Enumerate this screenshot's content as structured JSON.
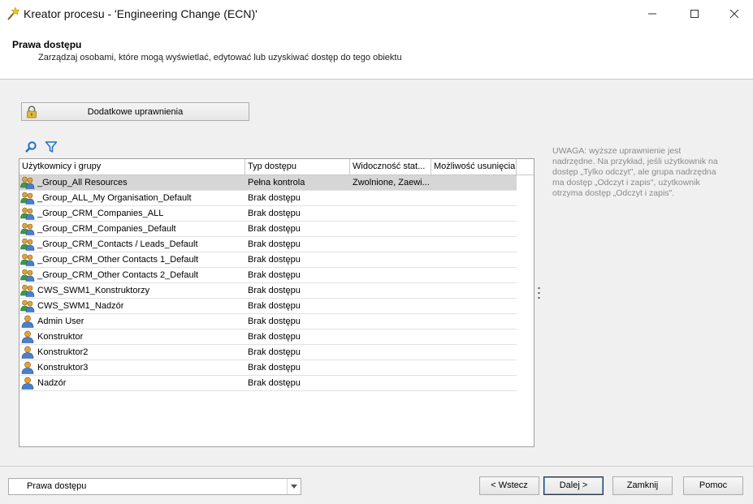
{
  "window": {
    "title": "Kreator procesu - 'Engineering Change (ECN)'"
  },
  "header": {
    "title": "Prawa dostępu",
    "subtitle": "Zarządzaj osobami, które mogą wyświetlać, edytować lub uzyskiwać dostęp do tego obiektu"
  },
  "toolbar": {
    "permissions_label": "Dodatkowe uprawnienia"
  },
  "grid": {
    "columns": [
      "Użytkownicy i grupy",
      "Typ dostępu",
      "Widoczność stat...",
      "Możliwość usunięcia"
    ],
    "rows": [
      {
        "name": "_Group_All Resources",
        "access": "Pełna kontrola",
        "visibility": "Zwolnione, Zaewi...",
        "deletion": "",
        "kind": "group"
      },
      {
        "name": "_Group_ALL_My Organisation_Default",
        "access": "Brak dostępu",
        "visibility": "",
        "deletion": "",
        "kind": "group"
      },
      {
        "name": "_Group_CRM_Companies_ALL",
        "access": "Brak dostępu",
        "visibility": "",
        "deletion": "",
        "kind": "group"
      },
      {
        "name": "_Group_CRM_Companies_Default",
        "access": "Brak dostępu",
        "visibility": "",
        "deletion": "",
        "kind": "group"
      },
      {
        "name": "_Group_CRM_Contacts / Leads_Default",
        "access": "Brak dostępu",
        "visibility": "",
        "deletion": "",
        "kind": "group"
      },
      {
        "name": "_Group_CRM_Other Contacts 1_Default",
        "access": "Brak dostępu",
        "visibility": "",
        "deletion": "",
        "kind": "group"
      },
      {
        "name": "_Group_CRM_Other Contacts 2_Default",
        "access": "Brak dostępu",
        "visibility": "",
        "deletion": "",
        "kind": "group"
      },
      {
        "name": "CWS_SWM1_Konstruktorzy",
        "access": "Brak dostępu",
        "visibility": "",
        "deletion": "",
        "kind": "group"
      },
      {
        "name": "CWS_SWM1_Nadzór",
        "access": "Brak dostępu",
        "visibility": "",
        "deletion": "",
        "kind": "group"
      },
      {
        "name": "Admin User",
        "access": "Brak dostępu",
        "visibility": "",
        "deletion": "",
        "kind": "user"
      },
      {
        "name": "Konstruktor",
        "access": "Brak dostępu",
        "visibility": "",
        "deletion": "",
        "kind": "user"
      },
      {
        "name": "Konstruktor2",
        "access": "Brak dostępu",
        "visibility": "",
        "deletion": "",
        "kind": "user"
      },
      {
        "name": "Konstruktor3",
        "access": "Brak dostępu",
        "visibility": "",
        "deletion": "",
        "kind": "user"
      },
      {
        "name": "Nadzór",
        "access": "Brak dostępu",
        "visibility": "",
        "deletion": "",
        "kind": "user"
      }
    ]
  },
  "note": "UWAGA: wyższe uprawnienie jest nadrzędne. Na przykład, jeśli użytkownik na dostęp „Tylko odczyt\", ale grupa nadrzędna ma dostęp „Odczyt i zapis\", użytkownik otrzyma dostęp „Odczyt i zapis\".",
  "footer": {
    "step_value": "Prawa dostępu",
    "back_label": "< Wstecz",
    "next_label": "Dalej >",
    "close_label": "Zamknij",
    "help_label": "Pomoc"
  },
  "icons": {
    "app": "wand-icon",
    "lock": "lock-icon",
    "search": "search-icon",
    "filter": "filter-icon",
    "group": "group-icon",
    "user": "user-icon"
  },
  "colors": {
    "accent": "#0078d7",
    "selected_row": "#d6d6d6",
    "note_text": "#8a8a8a"
  }
}
